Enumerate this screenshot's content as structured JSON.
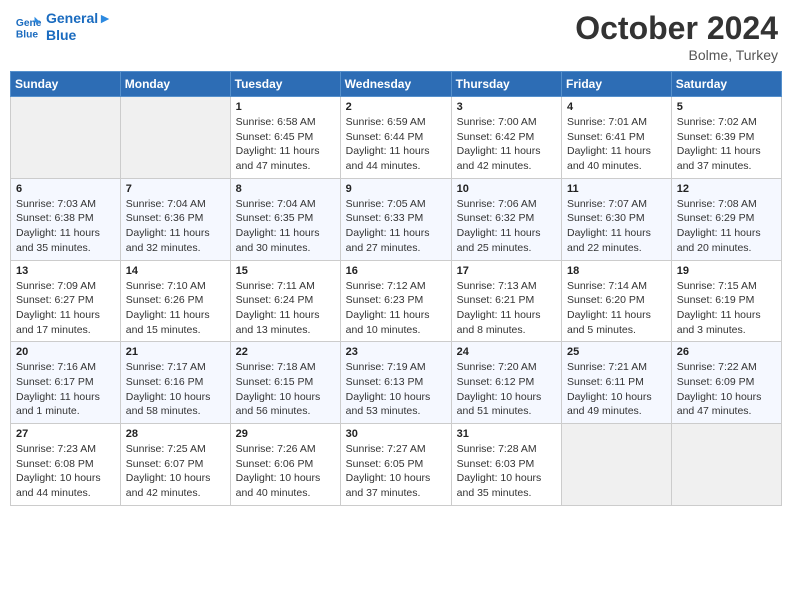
{
  "logo": {
    "line1": "General",
    "line2": "Blue"
  },
  "title": "October 2024",
  "location": "Bolme, Turkey",
  "header_days": [
    "Sunday",
    "Monday",
    "Tuesday",
    "Wednesday",
    "Thursday",
    "Friday",
    "Saturday"
  ],
  "weeks": [
    [
      {
        "day": "",
        "info": ""
      },
      {
        "day": "",
        "info": ""
      },
      {
        "day": "1",
        "info": "Sunrise: 6:58 AM\nSunset: 6:45 PM\nDaylight: 11 hours and 47 minutes."
      },
      {
        "day": "2",
        "info": "Sunrise: 6:59 AM\nSunset: 6:44 PM\nDaylight: 11 hours and 44 minutes."
      },
      {
        "day": "3",
        "info": "Sunrise: 7:00 AM\nSunset: 6:42 PM\nDaylight: 11 hours and 42 minutes."
      },
      {
        "day": "4",
        "info": "Sunrise: 7:01 AM\nSunset: 6:41 PM\nDaylight: 11 hours and 40 minutes."
      },
      {
        "day": "5",
        "info": "Sunrise: 7:02 AM\nSunset: 6:39 PM\nDaylight: 11 hours and 37 minutes."
      }
    ],
    [
      {
        "day": "6",
        "info": "Sunrise: 7:03 AM\nSunset: 6:38 PM\nDaylight: 11 hours and 35 minutes."
      },
      {
        "day": "7",
        "info": "Sunrise: 7:04 AM\nSunset: 6:36 PM\nDaylight: 11 hours and 32 minutes."
      },
      {
        "day": "8",
        "info": "Sunrise: 7:04 AM\nSunset: 6:35 PM\nDaylight: 11 hours and 30 minutes."
      },
      {
        "day": "9",
        "info": "Sunrise: 7:05 AM\nSunset: 6:33 PM\nDaylight: 11 hours and 27 minutes."
      },
      {
        "day": "10",
        "info": "Sunrise: 7:06 AM\nSunset: 6:32 PM\nDaylight: 11 hours and 25 minutes."
      },
      {
        "day": "11",
        "info": "Sunrise: 7:07 AM\nSunset: 6:30 PM\nDaylight: 11 hours and 22 minutes."
      },
      {
        "day": "12",
        "info": "Sunrise: 7:08 AM\nSunset: 6:29 PM\nDaylight: 11 hours and 20 minutes."
      }
    ],
    [
      {
        "day": "13",
        "info": "Sunrise: 7:09 AM\nSunset: 6:27 PM\nDaylight: 11 hours and 17 minutes."
      },
      {
        "day": "14",
        "info": "Sunrise: 7:10 AM\nSunset: 6:26 PM\nDaylight: 11 hours and 15 minutes."
      },
      {
        "day": "15",
        "info": "Sunrise: 7:11 AM\nSunset: 6:24 PM\nDaylight: 11 hours and 13 minutes."
      },
      {
        "day": "16",
        "info": "Sunrise: 7:12 AM\nSunset: 6:23 PM\nDaylight: 11 hours and 10 minutes."
      },
      {
        "day": "17",
        "info": "Sunrise: 7:13 AM\nSunset: 6:21 PM\nDaylight: 11 hours and 8 minutes."
      },
      {
        "day": "18",
        "info": "Sunrise: 7:14 AM\nSunset: 6:20 PM\nDaylight: 11 hours and 5 minutes."
      },
      {
        "day": "19",
        "info": "Sunrise: 7:15 AM\nSunset: 6:19 PM\nDaylight: 11 hours and 3 minutes."
      }
    ],
    [
      {
        "day": "20",
        "info": "Sunrise: 7:16 AM\nSunset: 6:17 PM\nDaylight: 11 hours and 1 minute."
      },
      {
        "day": "21",
        "info": "Sunrise: 7:17 AM\nSunset: 6:16 PM\nDaylight: 10 hours and 58 minutes."
      },
      {
        "day": "22",
        "info": "Sunrise: 7:18 AM\nSunset: 6:15 PM\nDaylight: 10 hours and 56 minutes."
      },
      {
        "day": "23",
        "info": "Sunrise: 7:19 AM\nSunset: 6:13 PM\nDaylight: 10 hours and 53 minutes."
      },
      {
        "day": "24",
        "info": "Sunrise: 7:20 AM\nSunset: 6:12 PM\nDaylight: 10 hours and 51 minutes."
      },
      {
        "day": "25",
        "info": "Sunrise: 7:21 AM\nSunset: 6:11 PM\nDaylight: 10 hours and 49 minutes."
      },
      {
        "day": "26",
        "info": "Sunrise: 7:22 AM\nSunset: 6:09 PM\nDaylight: 10 hours and 47 minutes."
      }
    ],
    [
      {
        "day": "27",
        "info": "Sunrise: 7:23 AM\nSunset: 6:08 PM\nDaylight: 10 hours and 44 minutes."
      },
      {
        "day": "28",
        "info": "Sunrise: 7:25 AM\nSunset: 6:07 PM\nDaylight: 10 hours and 42 minutes."
      },
      {
        "day": "29",
        "info": "Sunrise: 7:26 AM\nSunset: 6:06 PM\nDaylight: 10 hours and 40 minutes."
      },
      {
        "day": "30",
        "info": "Sunrise: 7:27 AM\nSunset: 6:05 PM\nDaylight: 10 hours and 37 minutes."
      },
      {
        "day": "31",
        "info": "Sunrise: 7:28 AM\nSunset: 6:03 PM\nDaylight: 10 hours and 35 minutes."
      },
      {
        "day": "",
        "info": ""
      },
      {
        "day": "",
        "info": ""
      }
    ]
  ]
}
